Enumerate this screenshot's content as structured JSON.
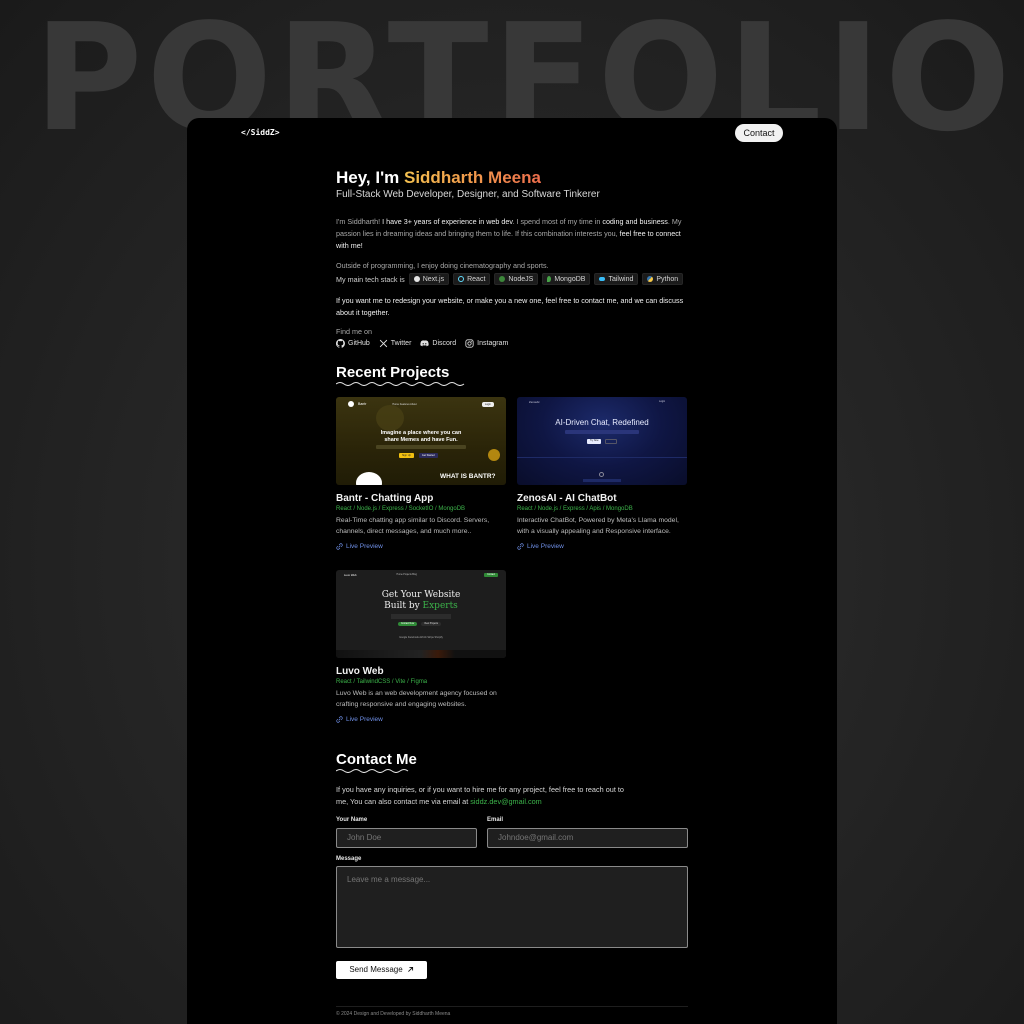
{
  "background": {
    "word": "PORTFOLIO"
  },
  "nav": {
    "logo": "</SiddZ>",
    "contact_label": "Contact"
  },
  "hero": {
    "greeting": "Hey, I'm ",
    "name": "Siddharth Meena",
    "subtitle": "Full-Stack Web Developer, Designer, and Software Tinkerer"
  },
  "about": {
    "p1_a": "I'm Siddharth! ",
    "p1_b": "I have 3+ years of experience in web dev",
    "p1_c": ". I spend most of my time in ",
    "p1_d": "coding and business",
    "p1_e": ". My passion lies in dreaming ideas and bringing them to life. If this combination interests you, ",
    "p1_f": "feel free to connect with me!",
    "p2": "Outside of programming, I enjoy doing cinematography and sports.",
    "stack_label": "My main tech stack is",
    "stack": [
      {
        "label": "Next.js",
        "icon": "nextjs-icon",
        "color": "#e6e6e6"
      },
      {
        "label": "React",
        "icon": "react-icon",
        "color": "#61dafb"
      },
      {
        "label": "NodeJS",
        "icon": "nodejs-icon",
        "color": "#3c873a"
      },
      {
        "label": "MongoDB",
        "icon": "mongodb-icon",
        "color": "#47a248"
      },
      {
        "label": "Tailwind",
        "icon": "tailwind-icon",
        "color": "#38bdf8"
      },
      {
        "label": "Python",
        "icon": "python-icon",
        "color": "#f7c948"
      }
    ],
    "p3": "If you want me to redesign your website, or make you a new one, feel free to contact me, and we can discuss about it together.",
    "find_label": "Find me on",
    "socials": [
      {
        "label": "GitHub",
        "icon": "github-icon"
      },
      {
        "label": "Twitter",
        "icon": "x-icon"
      },
      {
        "label": "Discord",
        "icon": "discord-icon"
      },
      {
        "label": "Instagram",
        "icon": "instagram-icon"
      }
    ]
  },
  "projects": {
    "title": "Recent Projects",
    "live_label": "Live Preview",
    "items": [
      {
        "title": "Bantr - Chatting App",
        "tags": "React / Node.js / Express / SocketIO / MongoDB",
        "desc": "Real-Time chatting app similar to Discord. Servers, channels, direct messages, and much more..",
        "thumb": {
          "brand": "Bantr",
          "nav": "Home  Features  About",
          "cta": "Login",
          "headline1": "Imagine a place where you can",
          "headline2": "share Memes and have Fun.",
          "btn1": "Sign Up",
          "btn2": "Get Started",
          "section": "WHAT IS BANTR?"
        }
      },
      {
        "title": "ZenosAI - AI ChatBot",
        "tags": "React / Node.js / Express / Apis / MongoDB",
        "desc": "Interactive ChatBot, Powered by Meta's Llama model, with a visually appealing and Responsive interface.",
        "thumb": {
          "brand": "ZenosAI",
          "nav": "Login",
          "headline": "AI-Driven Chat, Redefined",
          "btn1": "Try Now"
        }
      },
      {
        "title": "Luvo Web",
        "tags": "React / TailwindCSS / Vite / Figma",
        "desc": "Luvo Web is an web development agency focused on crafting responsive and engaging websites.",
        "thumb": {
          "brand": "Luvo Web",
          "nav": "Home  Projects  Blog",
          "cta": "Contact",
          "headline1": "Get Your Website",
          "headline2a": "Built by ",
          "headline2b": "Experts",
          "btn1": "Contact Now",
          "btn2": "View Projects",
          "logos": "Google  Facebook  Airbnb  Stripe  Shopify"
        }
      }
    ]
  },
  "contact": {
    "title": "Contact Me",
    "text": "If you have any inquiries, or if you want to hire me for any project, feel free to reach out to me, You can also contact me via email at ",
    "email": "siddz.dev@gmail.com",
    "name_label": "Your Name",
    "name_placeholder": "John Doe",
    "email_label": "Email",
    "email_placeholder": "Johndoe@gmail.com",
    "message_label": "Message",
    "message_placeholder": "Leave me a message...",
    "send_label": "Send Message"
  },
  "footer": {
    "text": "© 2024 Design and Developed by Siddharth Meena"
  }
}
